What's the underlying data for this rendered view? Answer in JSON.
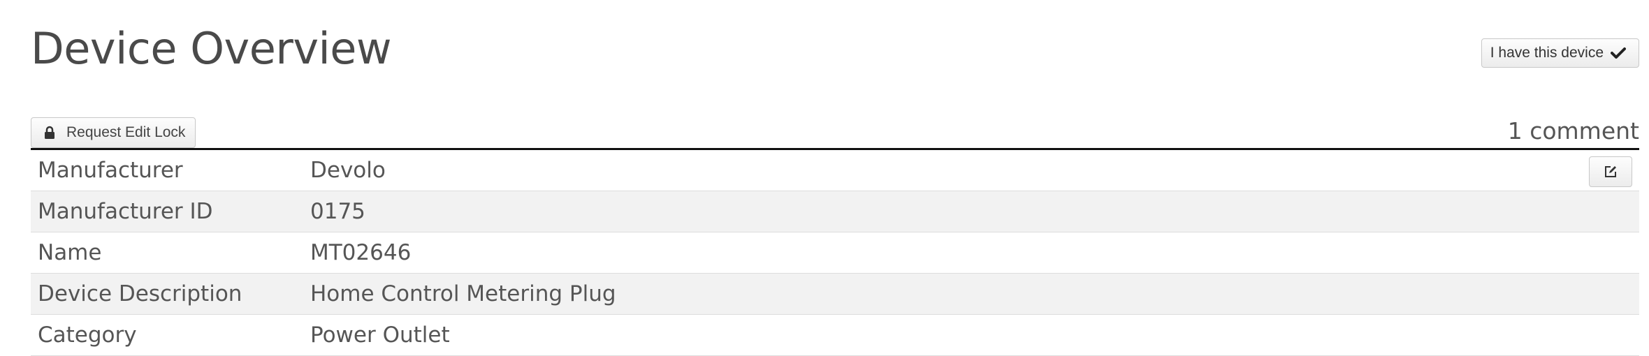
{
  "header": {
    "title": "Device Overview",
    "have_device_label": "I have this device",
    "have_device_icon": "check-icon"
  },
  "toolbar": {
    "lock_label": "Request Edit Lock",
    "lock_icon": "lock-icon",
    "comments": "1 comment",
    "edit_icon": "edit-icon"
  },
  "properties": [
    {
      "label": "Manufacturer",
      "value": "Devolo"
    },
    {
      "label": "Manufacturer ID",
      "value": "0175"
    },
    {
      "label": "Name",
      "value": "MT02646"
    },
    {
      "label": "Device Description",
      "value": "Home Control Metering Plug"
    },
    {
      "label": "Category",
      "value": "Power Outlet"
    }
  ],
  "colors": {
    "alt_row": "#f2f2f2",
    "rule": "#111111",
    "text": "#555555"
  }
}
